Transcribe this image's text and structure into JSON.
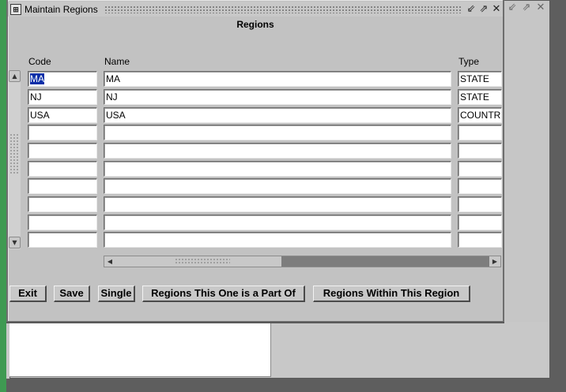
{
  "window": {
    "title": "Maintain Regions",
    "icon": "oracle-forms-icon",
    "controls": [
      "minimize-icon",
      "maximize-icon",
      "close-icon"
    ]
  },
  "back_window": {
    "controls": [
      "minimize-icon",
      "maximize-icon",
      "close-icon"
    ]
  },
  "form": {
    "title": "Regions",
    "columns": {
      "code": "Code",
      "name": "Name",
      "type": "Type"
    },
    "rows": [
      {
        "code": "MA",
        "name": "MA",
        "type": "STATE"
      },
      {
        "code": "NJ",
        "name": "NJ",
        "type": "STATE"
      },
      {
        "code": "USA",
        "name": "USA",
        "type": "COUNTR"
      },
      {
        "code": "",
        "name": "",
        "type": ""
      },
      {
        "code": "",
        "name": "",
        "type": ""
      },
      {
        "code": "",
        "name": "",
        "type": ""
      },
      {
        "code": "",
        "name": "",
        "type": ""
      },
      {
        "code": "",
        "name": "",
        "type": ""
      },
      {
        "code": "",
        "name": "",
        "type": ""
      },
      {
        "code": "",
        "name": "",
        "type": ""
      }
    ]
  },
  "buttons": {
    "exit": "Exit",
    "save": "Save",
    "single": "Single",
    "part_of": "Regions This One is a Part Of",
    "within": "Regions Within This Region"
  },
  "colors": {
    "selection": "#0a2fa8",
    "window_bg": "#c2c2c2",
    "desktop_accent": "#3f9a52"
  }
}
